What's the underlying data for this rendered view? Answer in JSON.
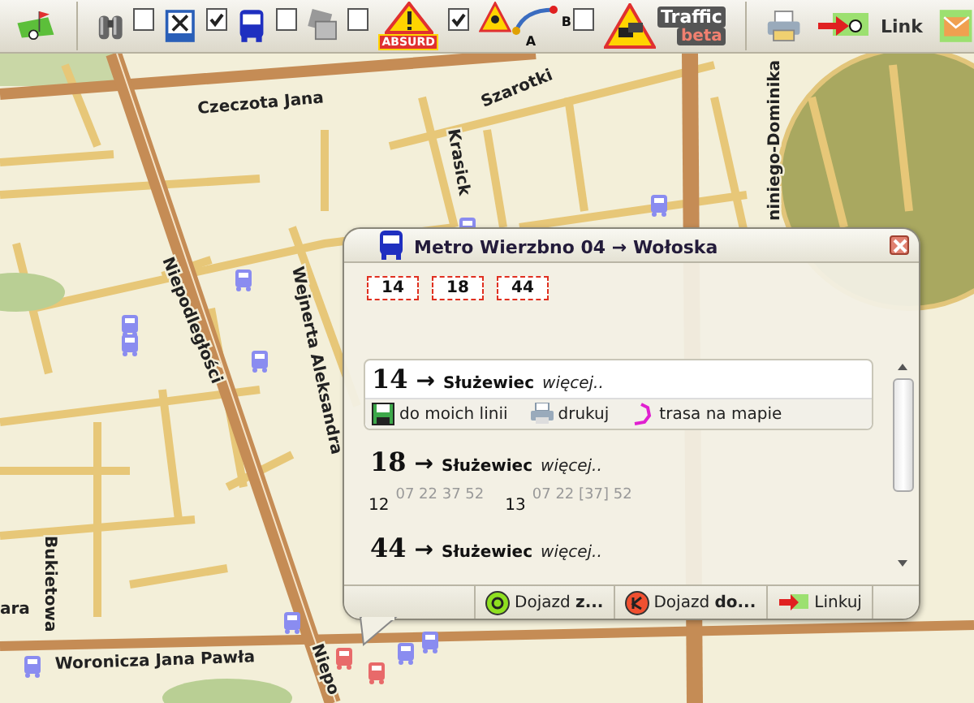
{
  "toolbar": {
    "layers": [
      {
        "kind": "restaurant",
        "checked": false
      },
      {
        "kind": "bus",
        "checked": true
      },
      {
        "kind": "camera",
        "checked": false
      },
      {
        "kind": "absurd",
        "checked": false,
        "label": "ABSURD"
      },
      {
        "kind": "route",
        "checked": true,
        "label_a": "A",
        "label_b": "B"
      },
      {
        "kind": "traffic",
        "checked": false,
        "label": "Traffic",
        "badge": "beta"
      }
    ],
    "link_label": "Link"
  },
  "map": {
    "street_labels": [
      "Szarotki",
      "Czeczota Jana",
      "Krasick",
      "Niepodległości",
      "Wejnerta Aleksandra",
      "Bukietowa",
      "ara",
      "Woronicza Jana Pawła",
      "niniego-Dominika",
      "Niepo"
    ]
  },
  "popup": {
    "title": "Metro Wierzbno 04 → Wołoska",
    "lines": [
      "14",
      "18",
      "44"
    ],
    "entries": [
      {
        "line": "14",
        "arrow": "→",
        "destination": "Służewiec",
        "more": "więcej..",
        "actions": [
          "do moich linii",
          "drukuj",
          "trasa na mapie"
        ]
      },
      {
        "line": "18",
        "arrow": "→",
        "destination": "Służewiec",
        "more": "więcej..",
        "times": [
          {
            "hour": "12",
            "minutes": "07 22 37 52"
          },
          {
            "hour": "13",
            "minutes": "07 22 [37] 52"
          }
        ]
      },
      {
        "line": "44",
        "arrow": "→",
        "destination": "Służewiec",
        "more": "więcej.."
      }
    ],
    "footer": [
      {
        "kind": "start",
        "text": "Dojazd **z...**"
      },
      {
        "kind": "end",
        "text": "Dojazd **do...**"
      },
      {
        "kind": "link",
        "text": "Linkuj"
      }
    ]
  }
}
